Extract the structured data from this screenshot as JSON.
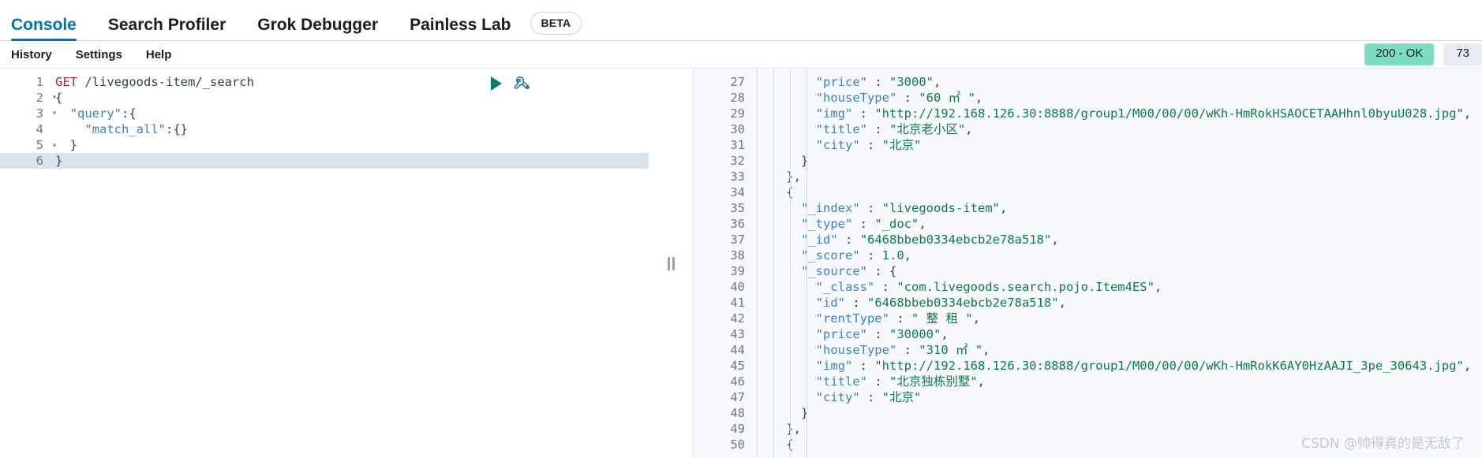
{
  "tabs": [
    {
      "label": "Console",
      "active": true
    },
    {
      "label": "Search Profiler",
      "active": false
    },
    {
      "label": "Grok Debugger",
      "active": false
    },
    {
      "label": "Painless Lab",
      "active": false
    }
  ],
  "beta_badge": "BETA",
  "subnav": [
    {
      "label": "History"
    },
    {
      "label": "Settings"
    },
    {
      "label": "Help"
    }
  ],
  "status": {
    "response_code": "200 - OK",
    "response_code_color": "#7dddc3",
    "elapsed_ms": "73",
    "elapsed_bg": "#e9edf3"
  },
  "actions": {
    "play": "play-icon",
    "wrench": "wrench-icon"
  },
  "request": {
    "lines": [
      {
        "n": "1",
        "fold": "",
        "text": "GET /livegoods-item/_search"
      },
      {
        "n": "2",
        "fold": "▾",
        "text": "{"
      },
      {
        "n": "3",
        "fold": "▾",
        "text": "  \"query\":{"
      },
      {
        "n": "4",
        "fold": "",
        "text": "    \"match_all\":{}"
      },
      {
        "n": "5",
        "fold": "▴",
        "text": "  }"
      },
      {
        "n": "6",
        "fold": "▴",
        "text": "}"
      }
    ]
  },
  "response": {
    "lines": [
      {
        "n": "27",
        "fold": "",
        "text": "        \"price\" : \"3000\","
      },
      {
        "n": "28",
        "fold": "",
        "text": "        \"houseType\" : \"60 ㎡ \","
      },
      {
        "n": "29",
        "fold": "",
        "text": "        \"img\" : \"http://192.168.126.30:8888/group1/M00/00/00/wKh-HmRokHSAOCETAAHhnl0byuU028.jpg\","
      },
      {
        "n": "30",
        "fold": "",
        "text": "        \"title\" : \"北京老小区\","
      },
      {
        "n": "31",
        "fold": "",
        "text": "        \"city\" : \"北京\""
      },
      {
        "n": "32",
        "fold": "▴",
        "text": "      }"
      },
      {
        "n": "33",
        "fold": "▴",
        "text": "    },"
      },
      {
        "n": "34",
        "fold": "▾",
        "text": "    {"
      },
      {
        "n": "35",
        "fold": "",
        "text": "      \"_index\" : \"livegoods-item\","
      },
      {
        "n": "36",
        "fold": "",
        "text": "      \"_type\" : \"_doc\","
      },
      {
        "n": "37",
        "fold": "",
        "text": "      \"_id\" : \"6468bbeb0334ebcb2e78a518\","
      },
      {
        "n": "38",
        "fold": "",
        "text": "      \"_score\" : 1.0,"
      },
      {
        "n": "39",
        "fold": "▾",
        "text": "      \"_source\" : {"
      },
      {
        "n": "40",
        "fold": "",
        "text": "        \"_class\" : \"com.livegoods.search.pojo.Item4ES\","
      },
      {
        "n": "41",
        "fold": "",
        "text": "        \"id\" : \"6468bbeb0334ebcb2e78a518\","
      },
      {
        "n": "42",
        "fold": "",
        "text": "        \"rentType\" : \" 整 租 \","
      },
      {
        "n": "43",
        "fold": "",
        "text": "        \"price\" : \"30000\","
      },
      {
        "n": "44",
        "fold": "",
        "text": "        \"houseType\" : \"310 ㎡ \","
      },
      {
        "n": "45",
        "fold": "",
        "text": "        \"img\" : \"http://192.168.126.30:8888/group1/M00/00/00/wKh-HmRokK6AY0HzAAJI_3pe_30643.jpg\","
      },
      {
        "n": "46",
        "fold": "",
        "text": "        \"title\" : \"北京独栋别墅\","
      },
      {
        "n": "47",
        "fold": "",
        "text": "        \"city\" : \"北京\""
      },
      {
        "n": "48",
        "fold": "▴",
        "text": "      }"
      },
      {
        "n": "49",
        "fold": "▴",
        "text": "    },"
      },
      {
        "n": "50",
        "fold": "▾",
        "text": "    {"
      }
    ]
  },
  "watermark": "CSDN @帅得真的是无敌了"
}
